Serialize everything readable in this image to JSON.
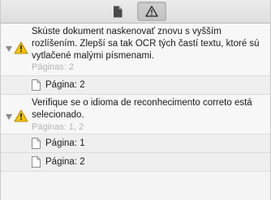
{
  "toolbar": {
    "tabs": [
      {
        "icon": "document-icon",
        "selected": false
      },
      {
        "icon": "warning-icon",
        "selected": true
      }
    ]
  },
  "issues": [
    {
      "message": "Skúste dokument naskenovať znovu s vyšším rozlíšením. Zlepší sa tak OCR tých častí textu, ktoré sú vytlačené malými písmenami.",
      "pages_label": "Páginas: 2",
      "pages": [
        "Página: 2"
      ]
    },
    {
      "message": "Verifique se o idioma de reconhecimento correto está selecionado.",
      "pages_label": "Páginas: 1, 2",
      "pages": [
        "Página: 1",
        "Página: 2"
      ]
    }
  ],
  "colors": {
    "warning_fill": "#f5c400",
    "warning_stroke": "#b88a00",
    "muted_text": "#b3b3b3"
  }
}
